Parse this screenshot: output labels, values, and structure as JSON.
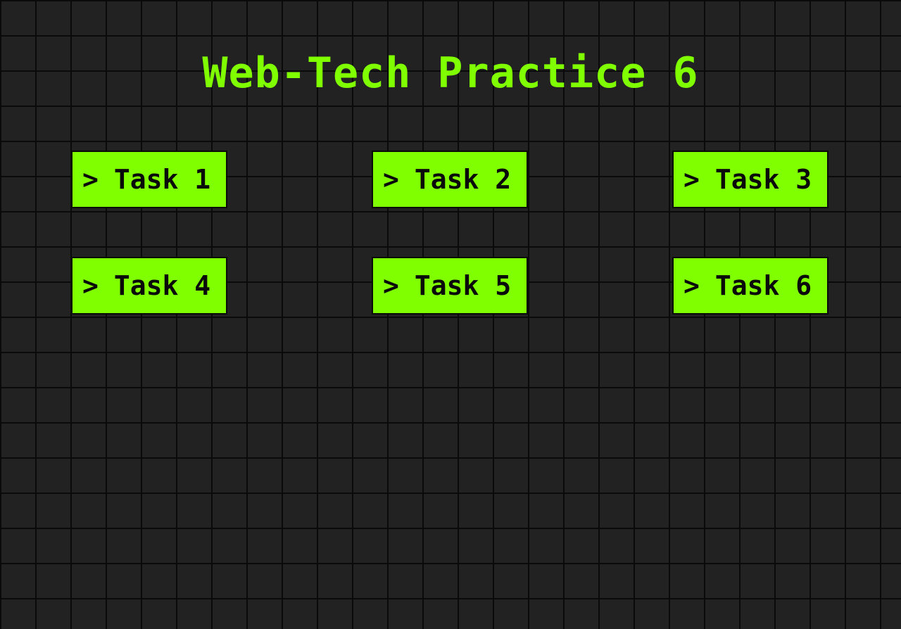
{
  "page": {
    "title": "Web-Tech Practice 6"
  },
  "theme": {
    "background": "#222222",
    "grid_line": "#0a0a0a",
    "accent": "#7fff00",
    "button_text": "#0a0a0a"
  },
  "tasks": [
    {
      "icon": "chevron-right-icon",
      "chevron": ">",
      "label": "Task 1"
    },
    {
      "icon": "chevron-right-icon",
      "chevron": ">",
      "label": "Task 2"
    },
    {
      "icon": "chevron-right-icon",
      "chevron": ">",
      "label": "Task 3"
    },
    {
      "icon": "chevron-right-icon",
      "chevron": ">",
      "label": "Task 4"
    },
    {
      "icon": "chevron-right-icon",
      "chevron": ">",
      "label": "Task 5"
    },
    {
      "icon": "chevron-right-icon",
      "chevron": ">",
      "label": "Task 6"
    }
  ]
}
